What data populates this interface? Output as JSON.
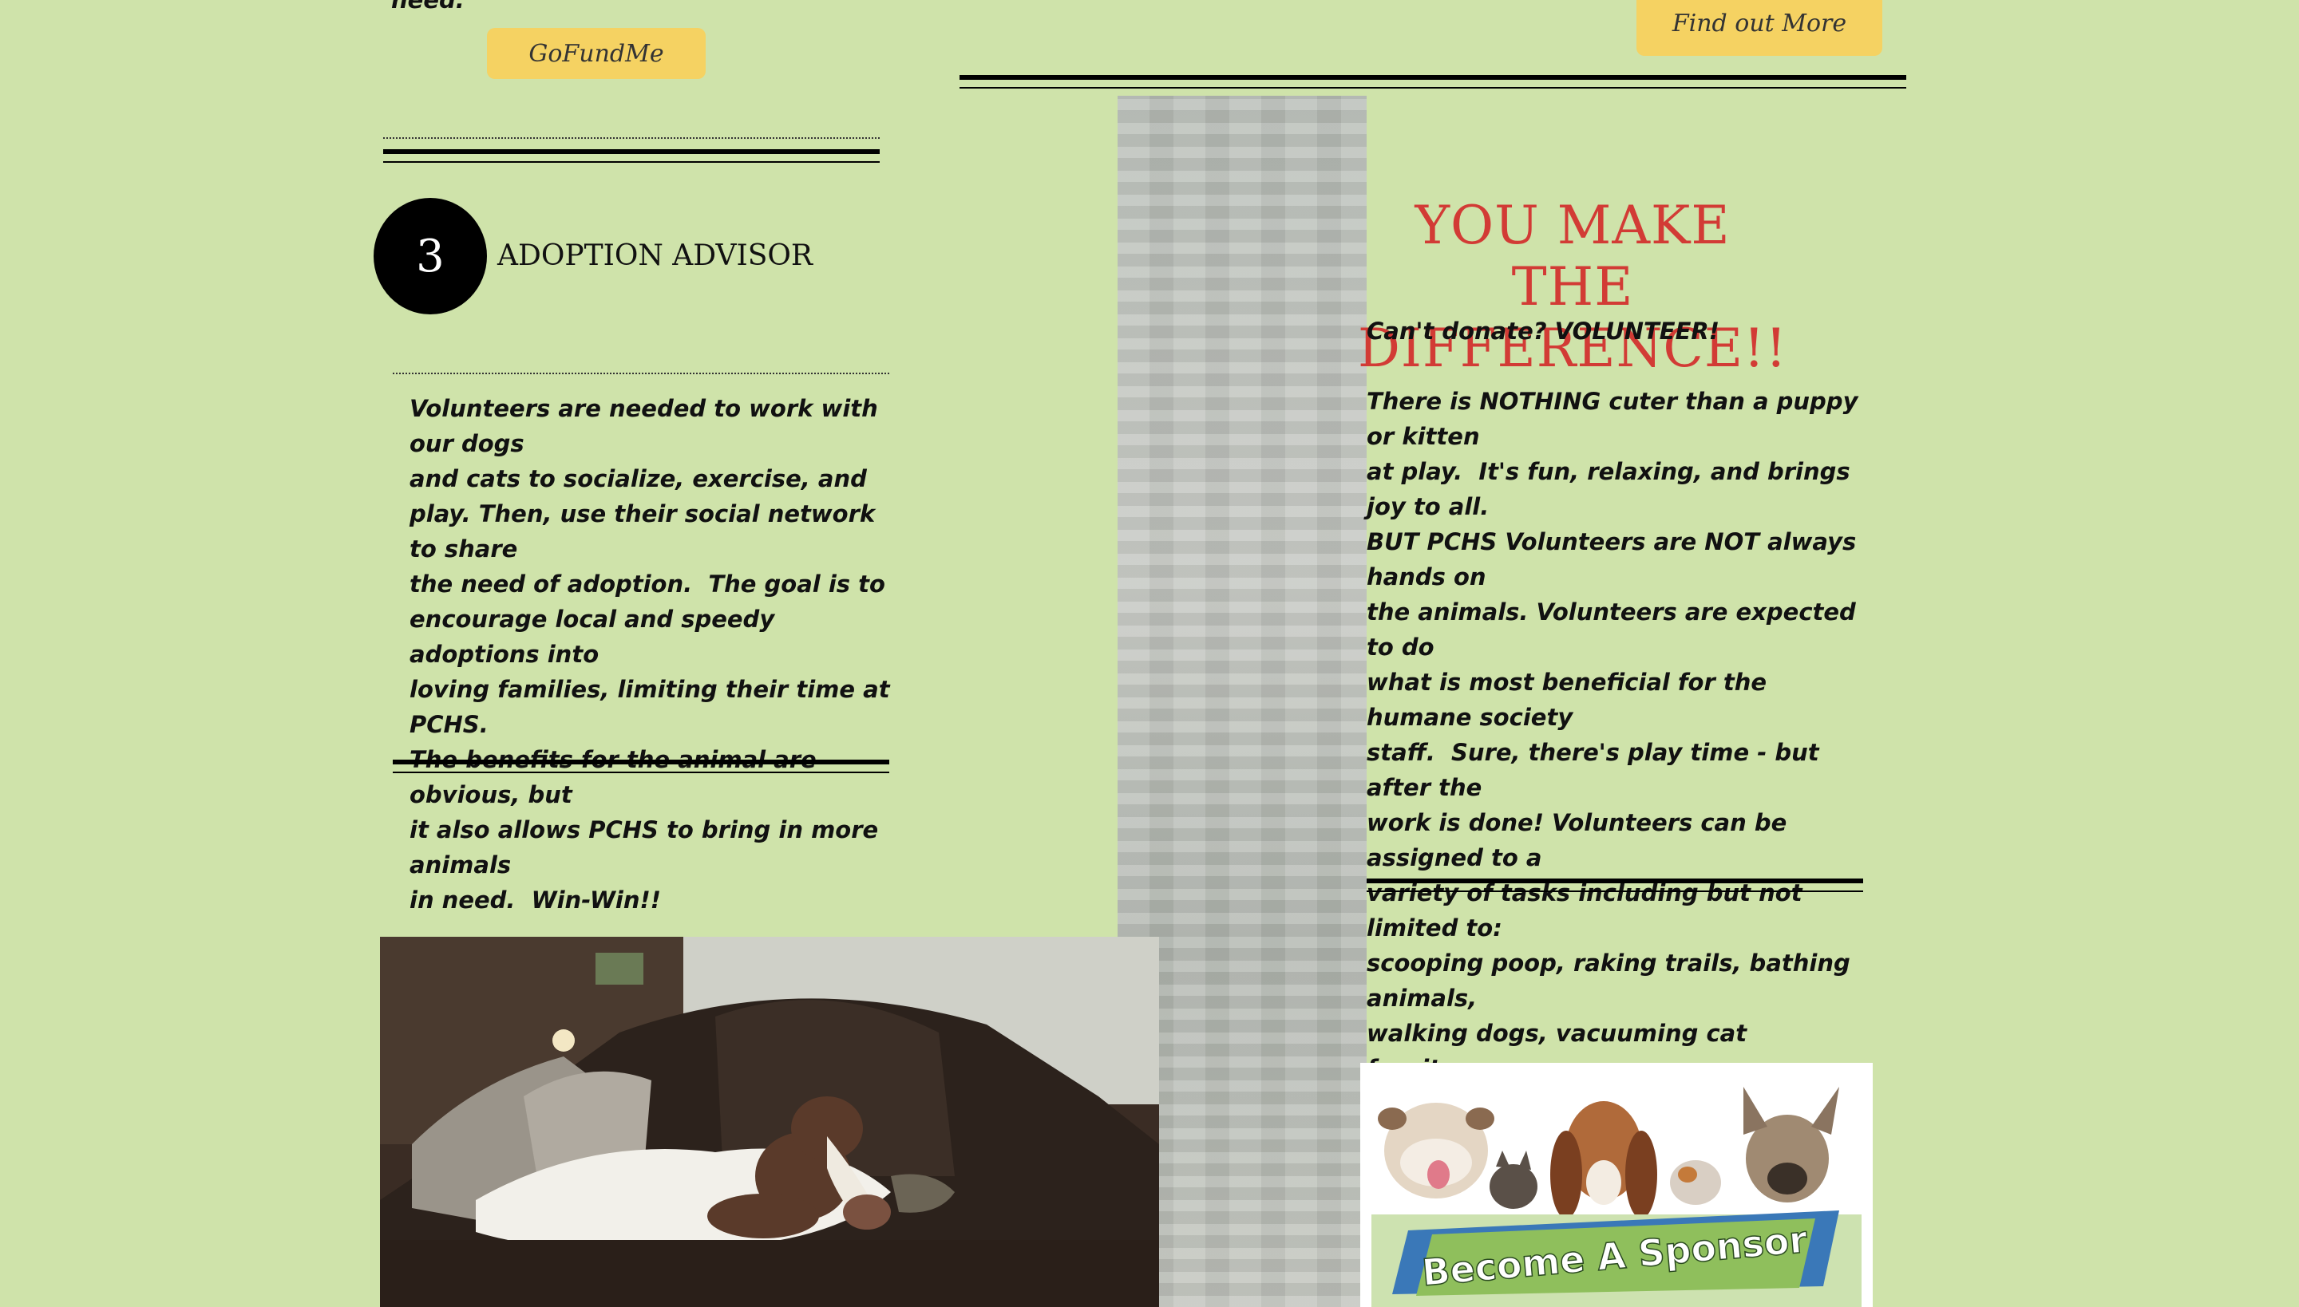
{
  "top_left_fragment": "need.",
  "buttons": {
    "gofundme": "GoFundMe",
    "find_out_more": "Find out More"
  },
  "step": {
    "number": "3",
    "title": "ADOPTION ADVISOR",
    "description": "Volunteers are needed to work with our dogs\nand cats to socialize, exercise, and\nplay. Then, use their social network to share\nthe need of adoption.  The goal is to\nencourage local and speedy adoptions into\nloving families, limiting their time at PCHS.\nThe benefits for the animal are obvious, but\nit also allows PCHS to bring in more animals\nin need.  Win-Win!!"
  },
  "difference": {
    "heading": "YOU MAKE THE\nDIFFERENCE!!",
    "subheading": "Can't donate? VOLUNTEER!",
    "body": "There is NOTHING cuter than a puppy or kitten\nat play.  It's fun, relaxing, and brings joy to all.\nBUT PCHS Volunteers are NOT always hands on\nthe animals. Volunteers are expected to do\nwhat is most beneficial for the humane society\nstaff.  Sure, there's play time - but after the\nwork is done! Volunteers can be assigned to a\nvariety of tasks including but not limited to:\nscooping poop, raking trails, bathing animals,\nwalking dogs, vacuuming cat furniture,\nsweeping/ mopping floors, scrubbing walls,\netc...  Still interested?  Contact us & we'll set\nup an orientation just for you!"
  },
  "sponsor_banner": {
    "label": "Become A Sponsor"
  },
  "icons": {
    "dog_photo": "sleeping-dog-on-couch-photo",
    "sponsor_image": "dogs-and-cats-sponsor-image"
  },
  "colors": {
    "background": "#cfe3aa",
    "button": "#f5d262",
    "heading_red": "#d23b35"
  }
}
